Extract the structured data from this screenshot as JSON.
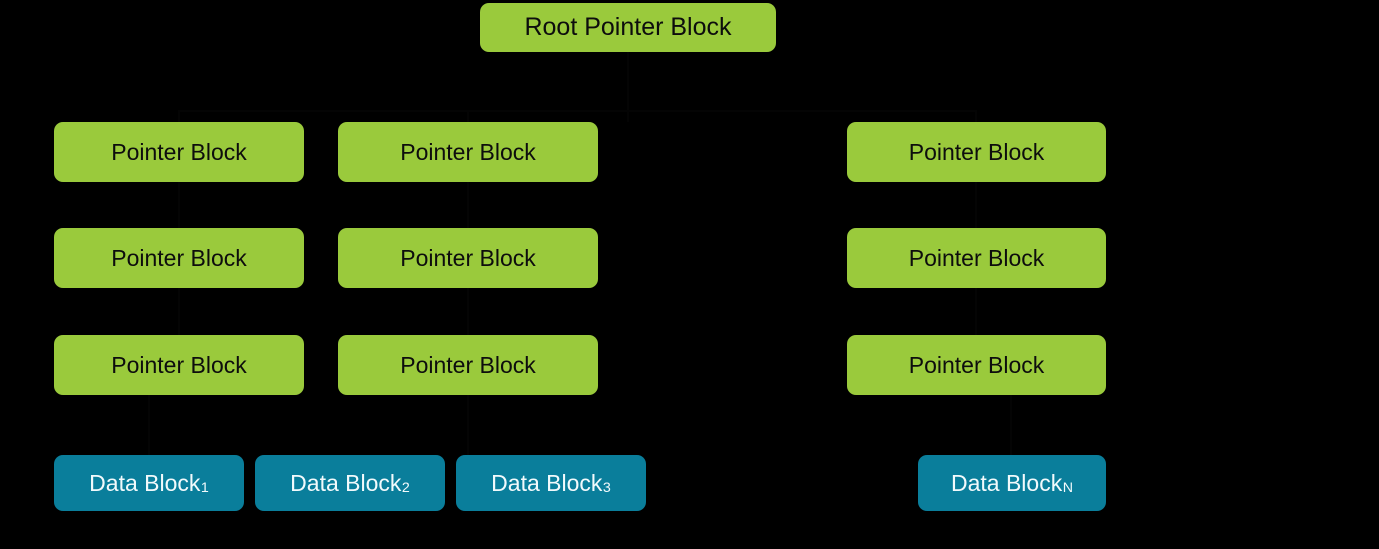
{
  "diagram": {
    "title": "Block pointer tree structure",
    "background_color": "#000000",
    "pointer_block_color": "#9ACA3C",
    "data_block_color": "#0A7E9B",
    "pointer_text_color": "#0D0D0D",
    "data_text_color": "#F2FAFC"
  },
  "root": {
    "label": "Root Pointer Block"
  },
  "pointer_rows": [
    {
      "row_label": "pointer-row-1",
      "blocks": [
        {
          "label": "Pointer Block"
        },
        {
          "label": "Pointer Block"
        },
        {
          "label": "Pointer Block"
        }
      ]
    },
    {
      "row_label": "pointer-row-2",
      "blocks": [
        {
          "label": "Pointer Block"
        },
        {
          "label": "Pointer Block"
        },
        {
          "label": "Pointer Block"
        }
      ]
    },
    {
      "row_label": "pointer-row-3",
      "blocks": [
        {
          "label": "Pointer Block"
        },
        {
          "label": "Pointer Block"
        },
        {
          "label": "Pointer Block"
        }
      ]
    }
  ],
  "data_blocks": [
    {
      "label": "Data Block",
      "subscript": "1"
    },
    {
      "label": "Data Block",
      "subscript": "2"
    },
    {
      "label": "Data Block",
      "subscript": "3"
    },
    {
      "label": "Data Block",
      "subscript": "N"
    }
  ]
}
